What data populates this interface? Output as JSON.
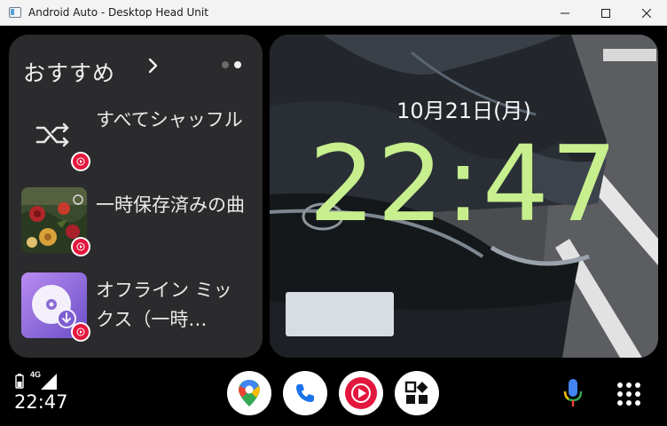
{
  "window": {
    "title": "Android Auto - Desktop Head Unit",
    "controls": [
      "minimize-icon",
      "maximize-icon",
      "close-icon"
    ]
  },
  "recommendations": {
    "title": "おすすめ",
    "page_count": 2,
    "active_page": 2,
    "items": [
      {
        "label": "すべてシャッフル",
        "art": "shuffle-icon",
        "badge": "youtube-music-icon"
      },
      {
        "label": "一時保存済みの曲",
        "art": "album-art-flowers",
        "badge": "youtube-music-icon"
      },
      {
        "label": "オフライン ミックス（一時…",
        "art": "offline-mix-icon",
        "badge": "youtube-music-icon"
      }
    ]
  },
  "clock": {
    "date": "10月21日(月)",
    "time": "22:47",
    "accent_color": "#c7ef8e"
  },
  "status": {
    "network": "4G",
    "time": "22:47",
    "icons": [
      "battery-icon",
      "signal-icon"
    ]
  },
  "dock": {
    "apps": [
      "google-maps-icon",
      "phone-icon",
      "youtube-music-icon",
      "apps-widget-icon"
    ],
    "assistant": "microphone-icon",
    "launcher": "app-launcher-icon"
  },
  "colors": {
    "youtube_red": "#e3173e",
    "card_bg": "#2b2b2d",
    "phone_blue": "#1a73e8"
  }
}
